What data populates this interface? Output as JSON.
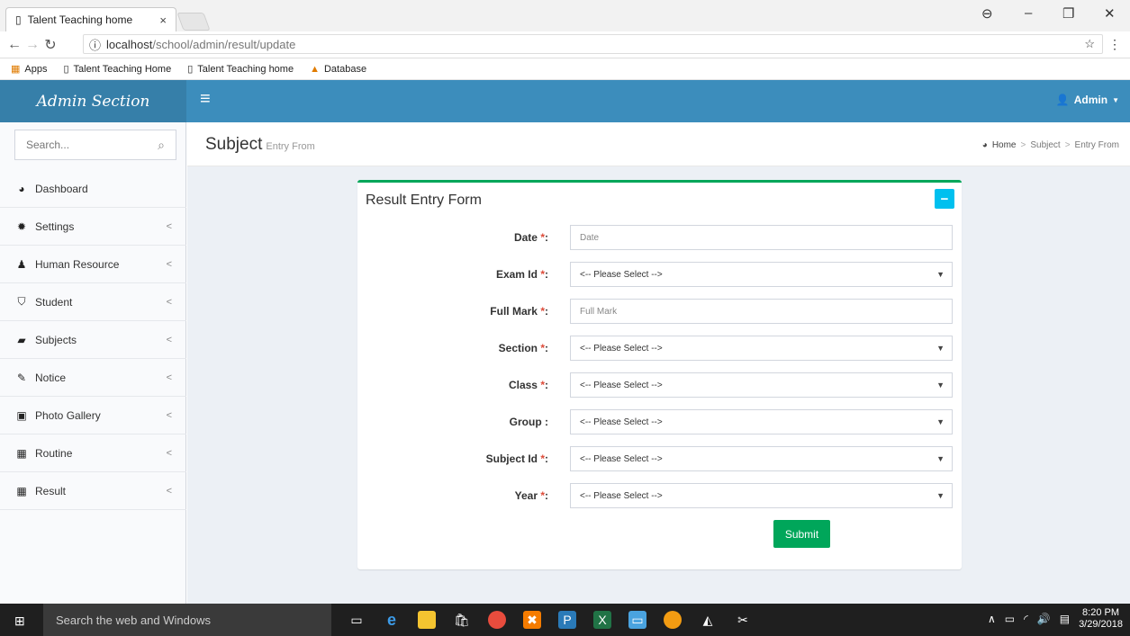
{
  "browser": {
    "tab_title": "Talent Teaching home",
    "tab_close": "×",
    "url_host": "localhost",
    "url_path": "/school/admin/result/update",
    "bookmarks": [
      "Apps",
      "Talent Teaching Home",
      "Talent Teaching home",
      "Database"
    ]
  },
  "header": {
    "logo": "Admin Section",
    "user": "Admin"
  },
  "sidebar": {
    "search_placeholder": "Search...",
    "items": [
      {
        "label": "Dashboard",
        "icon": "dashboard-icon",
        "glyph": "◕",
        "chev": ""
      },
      {
        "label": "Settings",
        "icon": "gear-icon",
        "glyph": "✹",
        "chev": "<"
      },
      {
        "label": "Human Resource",
        "icon": "users-icon",
        "glyph": "♟",
        "chev": "<"
      },
      {
        "label": "Student",
        "icon": "graduation-cap-icon",
        "glyph": "⛉",
        "chev": "<"
      },
      {
        "label": "Subjects",
        "icon": "book-icon",
        "glyph": "▰",
        "chev": "<"
      },
      {
        "label": "Notice",
        "icon": "edit-icon",
        "glyph": "✎",
        "chev": "<"
      },
      {
        "label": "Photo Gallery",
        "icon": "image-icon",
        "glyph": "▣",
        "chev": "<"
      },
      {
        "label": "Routine",
        "icon": "table-icon",
        "glyph": "▦",
        "chev": "<"
      },
      {
        "label": "Result",
        "icon": "table-icon",
        "glyph": "▦",
        "chev": "<"
      }
    ]
  },
  "page": {
    "title": "Subject",
    "subtitle": "Entry From",
    "breadcrumb": [
      "Home",
      "Subject",
      "Entry From"
    ]
  },
  "form": {
    "title": "Result Entry Form",
    "collapse": "−",
    "fields": [
      {
        "label": "Date",
        "required": true,
        "type": "input",
        "placeholder": "Date"
      },
      {
        "label": "Exam Id",
        "required": true,
        "type": "select",
        "value": "<-- Please Select -->"
      },
      {
        "label": "Full Mark",
        "required": true,
        "type": "input",
        "placeholder": "Full Mark"
      },
      {
        "label": "Section",
        "required": true,
        "type": "select",
        "value": "<-- Please Select -->"
      },
      {
        "label": "Class",
        "required": true,
        "type": "select",
        "value": "<-- Please Select -->"
      },
      {
        "label": "Group",
        "required": false,
        "type": "select",
        "value": "<-- Please Select -->"
      },
      {
        "label": "Subject Id",
        "required": true,
        "type": "select",
        "value": "<-- Please Select -->"
      },
      {
        "label": "Year",
        "required": true,
        "type": "select",
        "value": "<-- Please Select -->"
      }
    ],
    "submit": "Submit"
  },
  "taskbar": {
    "search": "Search the web and Windows",
    "time": "8:20 PM",
    "date": "3/29/2018"
  },
  "colors": {
    "header": "#3c8dbc",
    "logo_bg": "#367fa9",
    "box_border": "#00a65a",
    "collapse": "#00c0ef",
    "required": "#dd4b39"
  }
}
